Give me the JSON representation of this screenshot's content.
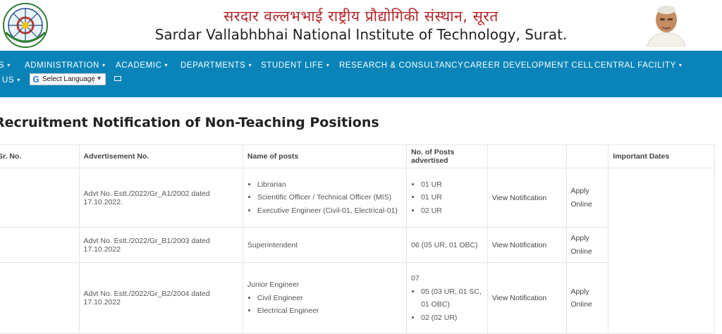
{
  "header": {
    "title_hindi": "सरदार वल्लभभाई राष्ट्रीय प्रौद्योगिकी संस्थान, सूरत",
    "title_english": "Sardar Vallabhbhai National Institute of Technology, Surat."
  },
  "nav": {
    "items": [
      {
        "label": "S",
        "dropdown": true
      },
      {
        "label": "ADMINISTRATION",
        "dropdown": true
      },
      {
        "label": "ACADEMIC",
        "dropdown": true
      },
      {
        "label": "DEPARTMENTS",
        "dropdown": true
      },
      {
        "label": "STUDENT LIFE",
        "dropdown": true
      },
      {
        "label": "RESEARCH & CONSULTANCY",
        "dropdown": false
      },
      {
        "label": "CAREER DEVELOPMENT CELL",
        "dropdown": false
      },
      {
        "label": "CENTRAL FACILITY",
        "dropdown": true
      },
      {
        "label": "US",
        "dropdown": true
      }
    ],
    "caret": "▾",
    "language_select": {
      "brand": "G",
      "label": "Select Language",
      "arrow": "▼"
    },
    "mail_icon": "mail-icon"
  },
  "page": {
    "heading": "Recruitment Notification of Non-Teaching Positions"
  },
  "table": {
    "headers": [
      "Sr. No.",
      "Advertisement No.",
      "Name of posts",
      "No. of Posts advertised",
      "",
      "",
      "Important Dates"
    ],
    "rows": [
      {
        "sr": "",
        "advt": "Advt No. Estt./2022/Gr_A1/2002 dated 17.10.2022.",
        "posts_title": "",
        "posts": [
          "Librarian",
          "Scientific Officer / Technical Officer (MIS)",
          "Executive Engineer (Civil-01, Electrical-01)"
        ],
        "counts_title": "",
        "counts": [
          "01 UR",
          "01 UR",
          "02 UR"
        ],
        "notification": "View Notification",
        "apply": "Apply Online"
      },
      {
        "sr": "",
        "advt": "Advt No. Estt./2022/Gr_B1/2003 dated 17.10.2022",
        "posts_title": "Superintendent",
        "posts": [],
        "counts_title": "06 (05 UR, 01 OBC)",
        "counts": [],
        "notification": "View Notification",
        "apply": "Apply Online"
      },
      {
        "sr": "",
        "advt": "Advt No. Estt./2022/Gr_B2/2004 dated 17.10.2022",
        "posts_title": "Junior Engineer",
        "posts": [
          "Civil Engineer",
          "Electrical Engineer"
        ],
        "counts_title": "07",
        "counts": [
          "05 (03 UR, 01 SC, 01 OBC)",
          "02 (02 UR)"
        ],
        "notification": "View Notification",
        "apply": "Apply Online"
      }
    ]
  },
  "colors": {
    "nav_bg": "#0a84b8",
    "hindi_title": "#b3262a",
    "heading": "#222222"
  }
}
